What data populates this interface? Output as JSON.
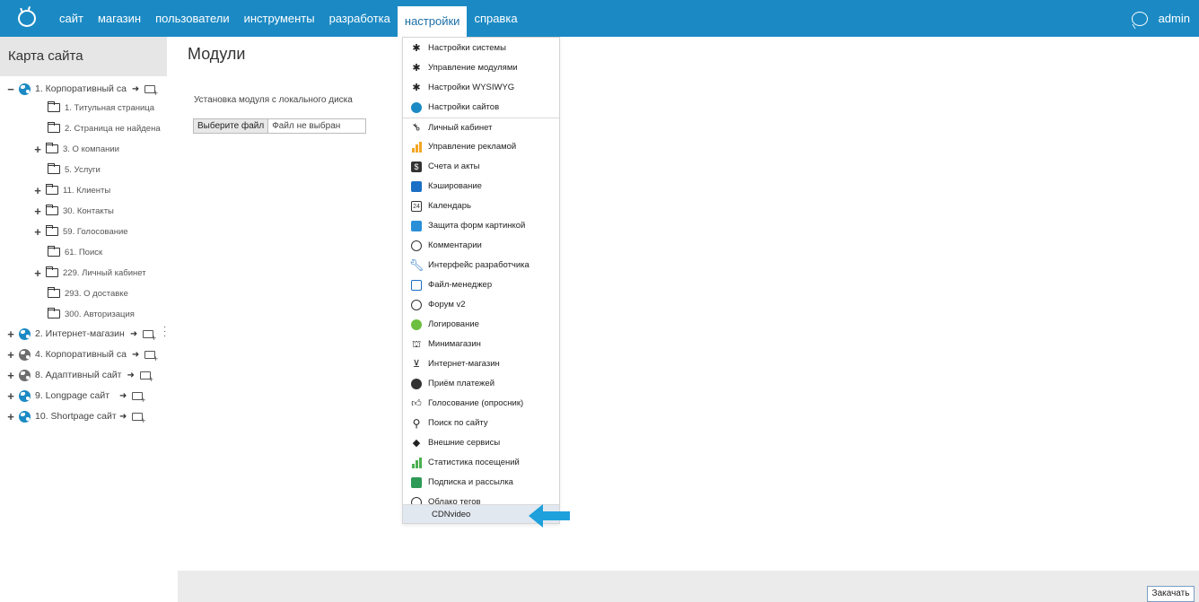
{
  "topbar": {
    "nav": [
      "сайт",
      "магазин",
      "пользователи",
      "инструменты",
      "разработка",
      "настройки",
      "справка"
    ],
    "active": "настройки",
    "user": "admin",
    "color": "#1b8ac4"
  },
  "sidebar": {
    "title": "Карта сайта",
    "tree": {
      "root1": "1. Корпоративный са",
      "children": [
        "1. Титульная страница",
        "2. Страница не найдена",
        "3. О компании",
        "5. Услуги",
        "11. Клиенты",
        "30. Контакты",
        "59. Голосование",
        "61. Поиск",
        "229. Личный кабинет",
        "293. О доставке",
        "300. Авторизация"
      ],
      "roots": [
        "2. Интернет-магазин",
        "4. Корпоративный са",
        "8. Адаптивный сайт",
        "9. Longpage сайт",
        "10. Shortpage сайт"
      ]
    }
  },
  "main": {
    "title": "Модули",
    "upload_label": "Установка модуля с локального диска",
    "file_button": "Выберите файл",
    "file_status": "Файл не выбран",
    "upload_button": "Закачать"
  },
  "menu": {
    "items": [
      {
        "label": "Настройки системы",
        "icon": "gear-icon"
      },
      {
        "label": "Управление модулями",
        "icon": "gear-icon"
      },
      {
        "label": "Настройки WYSIWYG",
        "icon": "gear-icon"
      },
      {
        "label": "Настройки сайтов",
        "icon": "globe-icon"
      },
      {
        "label": "Личный кабинет",
        "icon": "key-icon"
      },
      {
        "label": "Управление рекламой",
        "icon": "bar-chart-icon"
      },
      {
        "label": "Счета и акты",
        "icon": "invoice-icon"
      },
      {
        "label": "Кэширование",
        "icon": "cache-icon"
      },
      {
        "label": "Календарь",
        "icon": "calendar-icon"
      },
      {
        "label": "Защита форм картинкой",
        "icon": "captcha-icon"
      },
      {
        "label": "Комментарии",
        "icon": "comment-icon"
      },
      {
        "label": "Интерфейс разработчика",
        "icon": "wrench-icon"
      },
      {
        "label": "Файл-менеджер",
        "icon": "file-manager-icon"
      },
      {
        "label": "Форум v2",
        "icon": "forum-icon"
      },
      {
        "label": "Логирование",
        "icon": "log-icon"
      },
      {
        "label": "Минимагазин",
        "icon": "mini-shop-icon"
      },
      {
        "label": "Интернет-магазин",
        "icon": "cart-icon"
      },
      {
        "label": "Приём платежей",
        "icon": "payment-icon"
      },
      {
        "label": "Голосование (опросник)",
        "icon": "thumbs-up-icon"
      },
      {
        "label": "Поиск по сайту",
        "icon": "search-icon"
      },
      {
        "label": "Внешние сервисы",
        "icon": "external-services-icon"
      },
      {
        "label": "Статистика посещений",
        "icon": "stats-icon"
      },
      {
        "label": "Подписка и рассылка",
        "icon": "subscription-icon"
      },
      {
        "label": "Облако тегов",
        "icon": "tag-cloud-icon"
      },
      {
        "label": "CDNvideo",
        "icon": ""
      }
    ]
  }
}
